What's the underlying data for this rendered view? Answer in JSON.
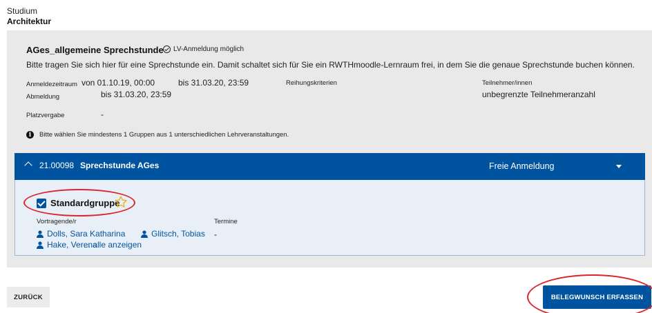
{
  "breadcrumb": {
    "level1": "Studium",
    "level2": "Architektur"
  },
  "course": {
    "title": "AGes_allgemeine Sprechstunde",
    "badge": "LV-Anmeldung möglich",
    "description": "Bitte tragen Sie sich hier für eine Sprechstunde ein. Damit schaltet sich für Sie ein RWTHmoodle-Lernraum frei, in dem Sie die genaue Sprechstunde buchen können."
  },
  "registration": {
    "period_label": "Anmeldezeitraum",
    "period_from": "von 01.10.19, 00:00",
    "period_to": "bis 31.03.20, 23:59",
    "deregistration_label": "Abmeldung",
    "deregistration_value": "bis 31.03.20, 23:59",
    "ranking_label": "Reihungskriterien",
    "participants_label": "Teilnehmer/innen",
    "participants_value": "unbegrenzte Teilnehmeranzahl",
    "allocation_label": "Platzvergabe",
    "allocation_value": "-"
  },
  "info_text": "Bitte wählen Sie mindestens 1 Gruppen aus 1 unterschiedlichen Lehrveranstaltungen.",
  "group": {
    "number": "21.00098",
    "title": "Sprechstunde AGes",
    "status": "Freie Anmeldung",
    "name": "Standardgruppe",
    "checked": true,
    "lecturers_label": "Vortragende/r",
    "dates_label": "Termine",
    "dates_value": "-",
    "lecturers": [
      "Dolls, Sara Katharina",
      "Glitsch, Tobias",
      "Hake, Verena"
    ],
    "show_all": "... alle anzeigen"
  },
  "buttons": {
    "back": "ZURÜCK",
    "submit": "BELEGWUNSCH ERFASSEN"
  },
  "colors": {
    "primary": "#00549f",
    "panel": "#e9e9e9",
    "annotation": "#d9262c"
  },
  "icons": [
    "check-circle-icon",
    "info-icon",
    "chevron-up-icon",
    "caret-down-icon",
    "star-icon",
    "person-icon"
  ]
}
